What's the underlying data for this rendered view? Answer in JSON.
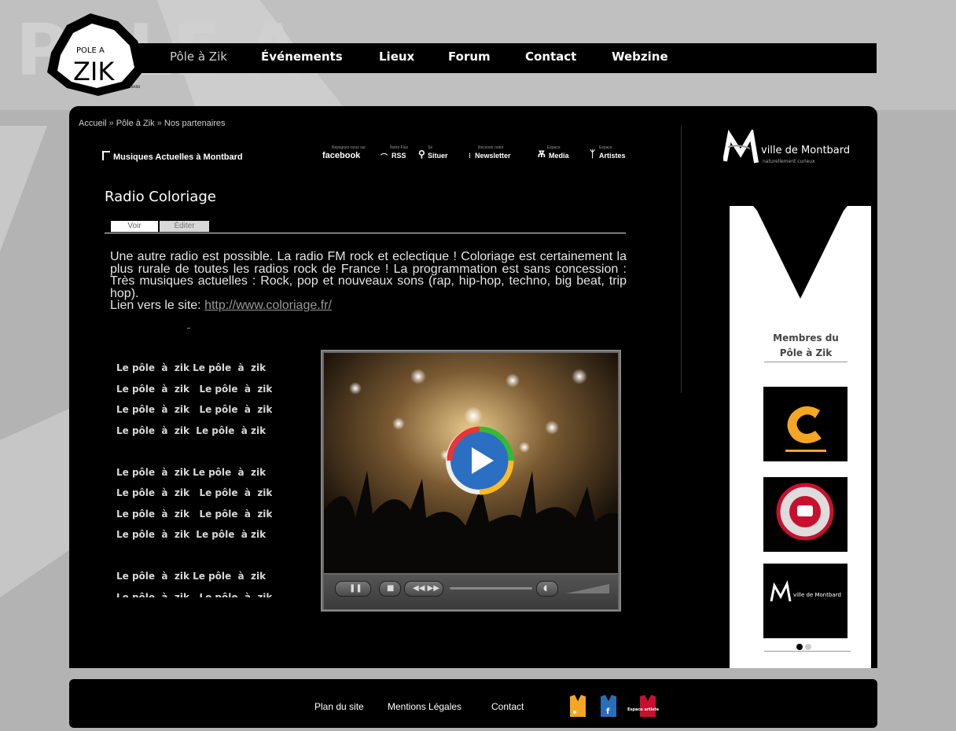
{
  "logo": {
    "line1": "POLE A",
    "line2": "ZIK",
    "line3": "MONTBARD"
  },
  "nav": {
    "items": [
      "Pôle à Zik",
      "Événements",
      "Lieux",
      "Forum",
      "Contact",
      "Webzine"
    ]
  },
  "breadcrumb": {
    "items": [
      "Accueil",
      "Pôle à Zik",
      "Nos partenaires"
    ],
    "separator": "»"
  },
  "header": {
    "music_logo": "Musiques Actuelles à Montbard",
    "social": [
      {
        "small": "Rejoignez-nous sur",
        "label": "facebook"
      },
      {
        "small": "Notre Flux",
        "label": "RSS"
      },
      {
        "small": "Se",
        "label": "Situer"
      },
      {
        "small": "Recevoir notre",
        "label": "Newsletter"
      },
      {
        "small": "Espace",
        "label": "Media"
      },
      {
        "small": "Espace",
        "label": "Artistes"
      }
    ]
  },
  "page": {
    "title": "Radio Coloriage",
    "tabs": [
      "Voir",
      "Éditer"
    ],
    "body": "Une autre radio est possible. La radio FM rock et eclectique ! Coloriage est certainement la plus rurale de toutes les radios rock de France ! La programmation est sans concession : Très musiques actuelles : Rock, pop et nouveaux sons (rap, hip-hop, techno, big beat, trip hop).",
    "link_prefix": "Lien vers le site: ",
    "link_text": "http://www.coloriage.fr/"
  },
  "zik_text": "Le pôle  à  zik Le pôle  à  zik\nLe pôle  à  zik   Le pôle  à  zik\nLe pôle  à  zik   Le pôle  à  zik\nLe pôle  à  zik  Le pôle  à zik\n\nLe pôle  à  zik Le pôle  à  zik\nLe pôle  à  zik   Le pôle  à  zik\nLe pôle  à  zik   Le pôle  à  zik\nLe pôle  à  zik  Le pôle  à zik\n\nLe pôle  à  zik Le pôle  à  zik\nLe pôle  à  zik   Le pôle  à  zik",
  "sidebar": {
    "ville_title": "ville de Montbard",
    "ville_sub": "naturellement curieux",
    "members_title": "Membres du Pôle à Zik",
    "partner3_label": "ville de Montbard"
  },
  "footer": {
    "links": [
      "Plan du site",
      "Mentions Légales",
      "Contact"
    ],
    "espace_label": "Espace artiste"
  },
  "colors": {
    "accent_orange": "#f5a623",
    "accent_blue": "#2a6ebb",
    "accent_red": "#c8102e"
  }
}
